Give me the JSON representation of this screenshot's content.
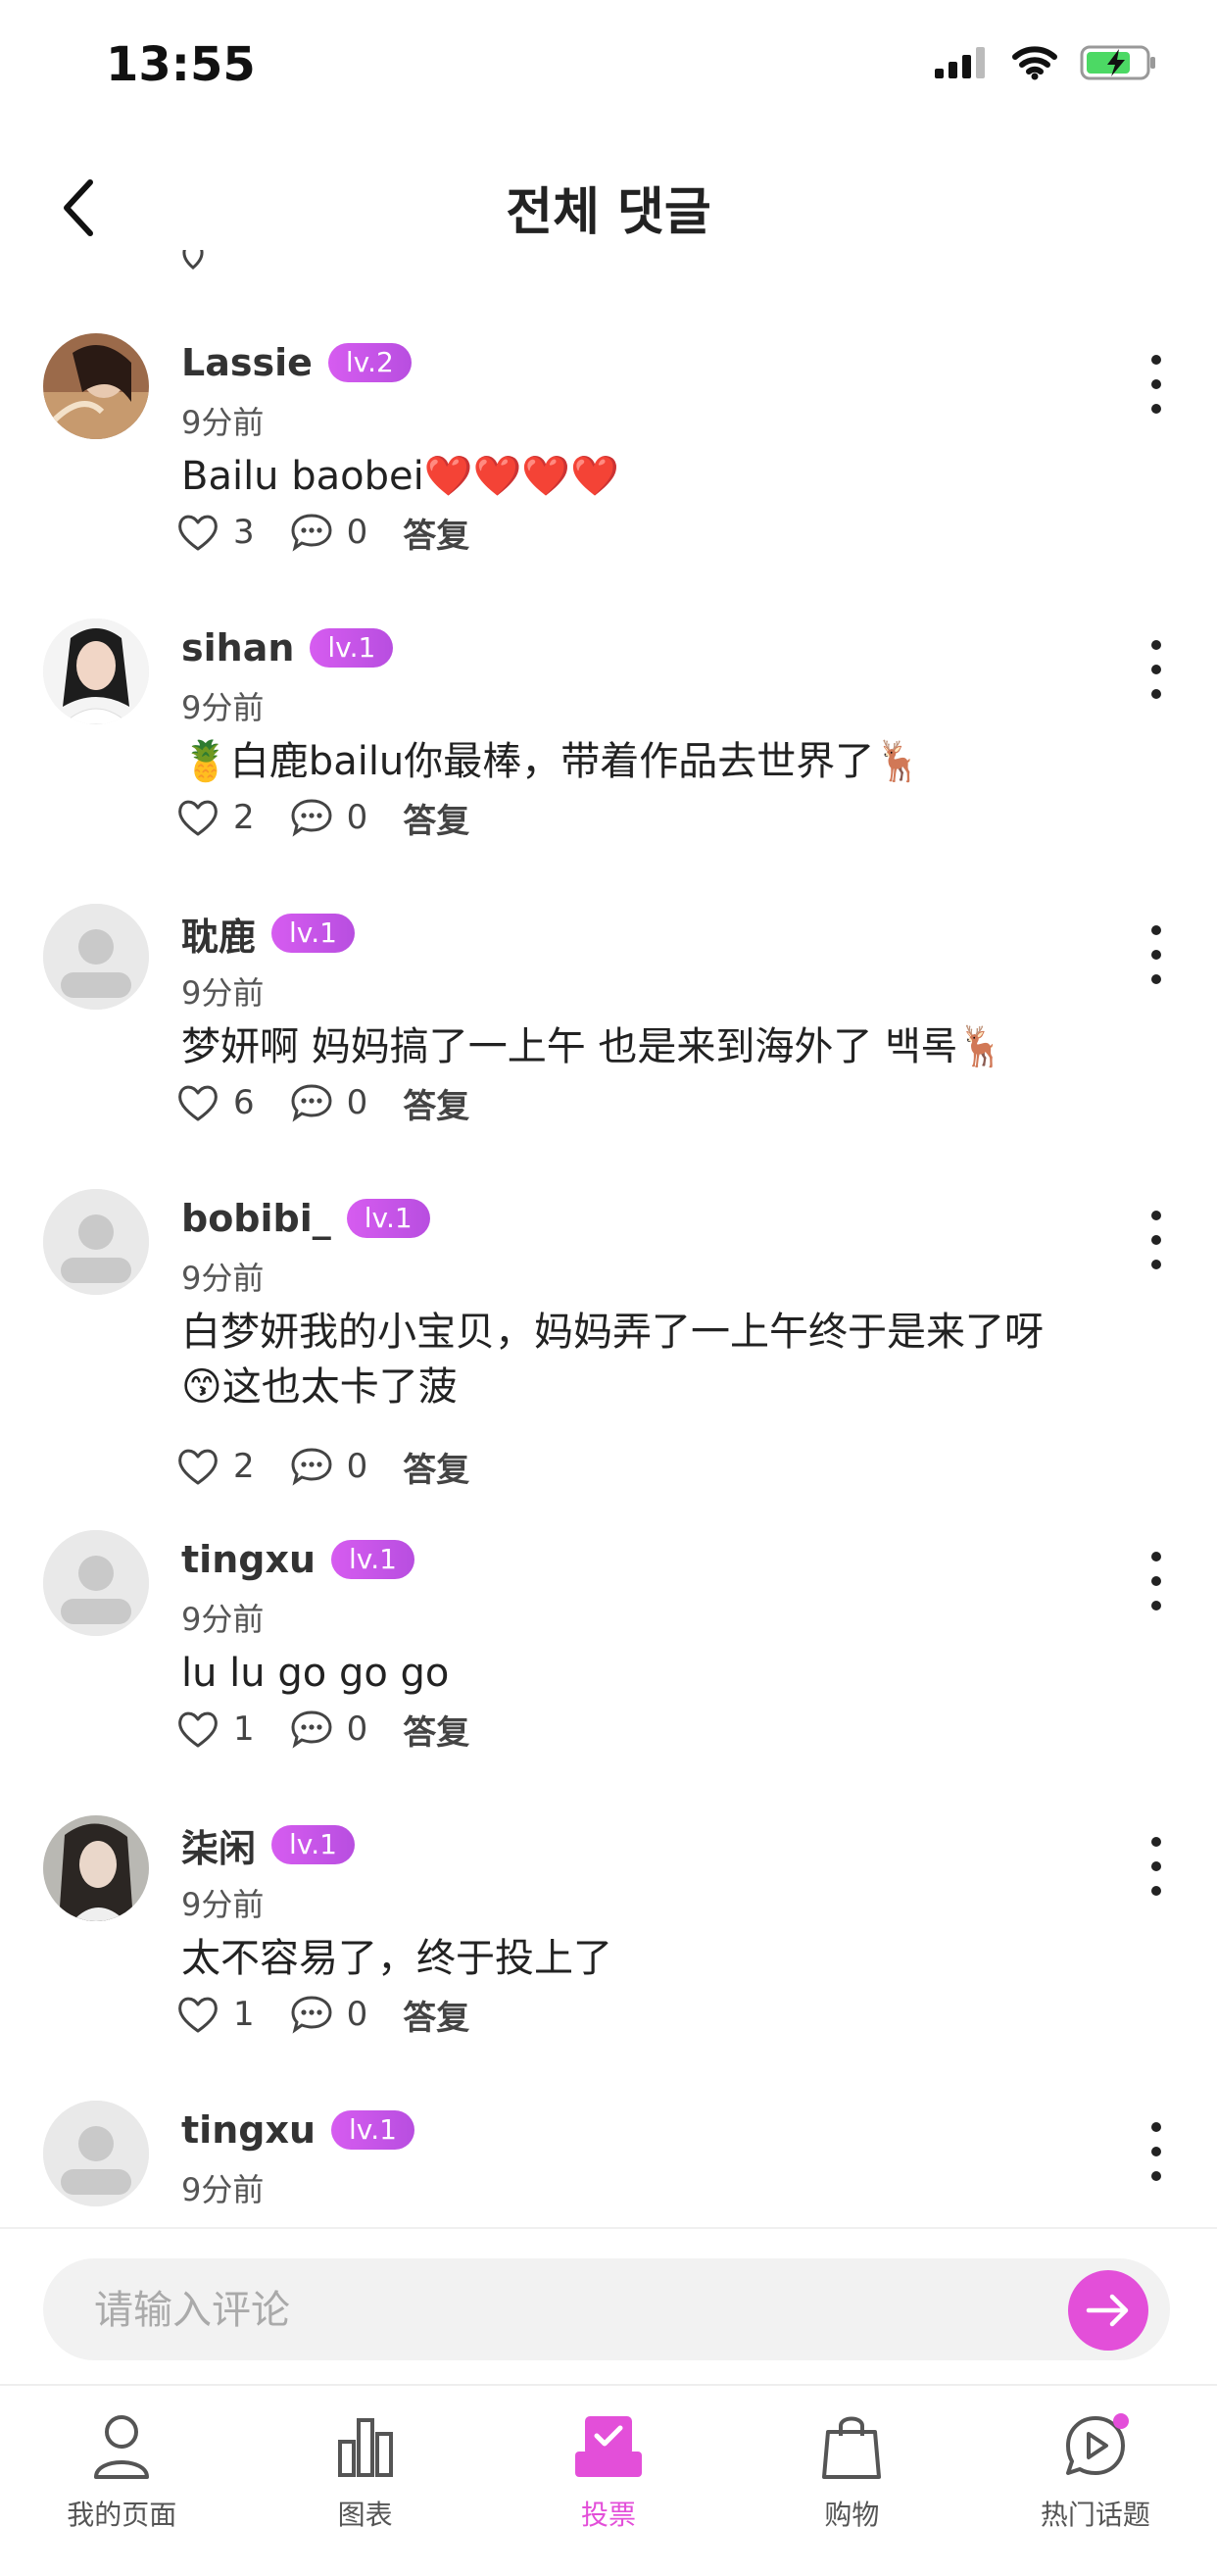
{
  "status_bar": {
    "time": "13:55"
  },
  "header": {
    "title": "전체 댓글"
  },
  "comments": [
    {
      "username": "Lassie",
      "level": "lv.2",
      "time": "9分前",
      "text": "Bailu baobei❤️❤️❤️❤️",
      "likes": "3",
      "replies": "0",
      "reply_label": "答复"
    },
    {
      "username": "sihan",
      "level": "lv.1",
      "time": "9分前",
      "text": "🍍白鹿bailu你最棒，带着作品去世界了🦌",
      "likes": "2",
      "replies": "0",
      "reply_label": "答复"
    },
    {
      "username": "耽鹿",
      "level": "lv.1",
      "time": "9分前",
      "text": "梦妍啊 妈妈搞了一上午 也是来到海外了 백록🦌",
      "likes": "6",
      "replies": "0",
      "reply_label": "答复"
    },
    {
      "username": "bobibi_",
      "level": "lv.1",
      "time": "9分前",
      "text": "白梦妍我的小宝贝，妈妈弄了一上午终于是来了呀😙这也太卡了菠",
      "likes": "2",
      "replies": "0",
      "reply_label": "答复"
    },
    {
      "username": "tingxu",
      "level": "lv.1",
      "time": "9分前",
      "text": "lu lu go go go",
      "likes": "1",
      "replies": "0",
      "reply_label": "答复"
    },
    {
      "username": "柒闲",
      "level": "lv.1",
      "time": "9分前",
      "text": "太不容易了，终于投上了",
      "likes": "1",
      "replies": "0",
      "reply_label": "答复"
    },
    {
      "username": "tingxu",
      "level": "lv.1",
      "time": "9分前"
    }
  ],
  "input": {
    "placeholder": "请输入评论"
  },
  "tabs": [
    {
      "label": "我的页面",
      "icon": "person-icon"
    },
    {
      "label": "图表",
      "icon": "chart-icon"
    },
    {
      "label": "投票",
      "icon": "vote-icon",
      "active": true
    },
    {
      "label": "购物",
      "icon": "shopping-bag-icon"
    },
    {
      "label": "热门话题",
      "icon": "trending-chat-icon"
    }
  ],
  "colors": {
    "accent": "#e34fd9",
    "badge": "#c956e8"
  }
}
